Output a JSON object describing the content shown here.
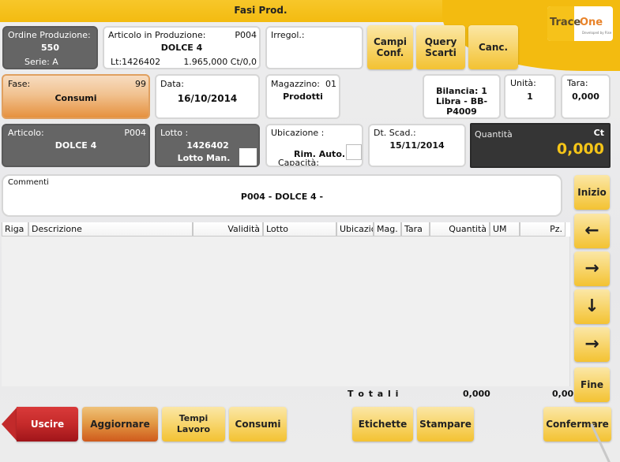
{
  "header": {
    "title": "Fasi Prod.",
    "logo": {
      "word1": "Trace",
      "word2": "One",
      "tagline": "Developed by Rise"
    }
  },
  "ordine": {
    "label": "Ordine Produzione:",
    "value": "550",
    "serie": "Serie:  A"
  },
  "articolo_prod": {
    "label": "Articolo in Produzione:",
    "code": "P004",
    "name": "DOLCE 4",
    "lotto": "Lt:1426402",
    "qty": "1.965,000 Ct/0,0"
  },
  "irregol": {
    "label": "Irregol.:",
    "value": ""
  },
  "top_buttons": {
    "campi": "Campi Conf.",
    "query": "Query Scarti",
    "canc": "Canc."
  },
  "fase": {
    "label": "Fase:",
    "code": "99",
    "value": "Consumi"
  },
  "data": {
    "label": "Data:",
    "value": "16/10/2014"
  },
  "magazzino": {
    "label": "Magazzino:",
    "code": "01",
    "value": "Prodotti"
  },
  "bilancia": {
    "line1": "Bilancia: 1",
    "line2": "Libra - BB-P4009"
  },
  "unita": {
    "label": "Unità:",
    "value": "1"
  },
  "tara": {
    "label": "Tara:",
    "value": "0,000"
  },
  "articolo": {
    "label": "Articolo:",
    "code": "P004",
    "value": "DOLCE 4"
  },
  "lotto": {
    "label": "Lotto :",
    "value": "1426402",
    "manual_label": "Lotto Man.",
    "manual_checked": false
  },
  "ubicazione": {
    "label": "Ubicazione :",
    "rim_auto": "Rim. Auto.:",
    "capacita": "Capacità:"
  },
  "scadenza": {
    "label": "Dt. Scad.:",
    "value": "15/11/2014"
  },
  "quantita": {
    "label": "Quantità",
    "unit": "Ct",
    "value": "0,000",
    "value_color": "#f5c518"
  },
  "commenti": {
    "label": "Commenti",
    "value": "P004 - DOLCE 4 -"
  },
  "table": {
    "columns": [
      "Riga",
      "Descrizione",
      "Validità",
      "Lotto",
      "Ubicazio",
      "Mag.",
      "Tara",
      "Quantità",
      "UM",
      "Pz."
    ],
    "rows": []
  },
  "totals": {
    "label": "T o t a l i",
    "quantita": "0,000",
    "pz": "0,00"
  },
  "nav_buttons": {
    "inizio": "Inizio",
    "prev": "🡐",
    "next": "🡒",
    "down": "🡓",
    "next2": "🡒",
    "fine": "Fine"
  },
  "bottom_buttons": {
    "uscire": "Uscire",
    "aggiornare": "Aggiornare",
    "tempi": "Tempi Lavoro",
    "consumi": "Consumi",
    "etichette": "Etichette",
    "stampare": "Stampare",
    "confermare": "Confermare"
  },
  "colors": {
    "accent": "#f3bb10",
    "exit": "#c22a2b",
    "orange": "#e39a45"
  }
}
